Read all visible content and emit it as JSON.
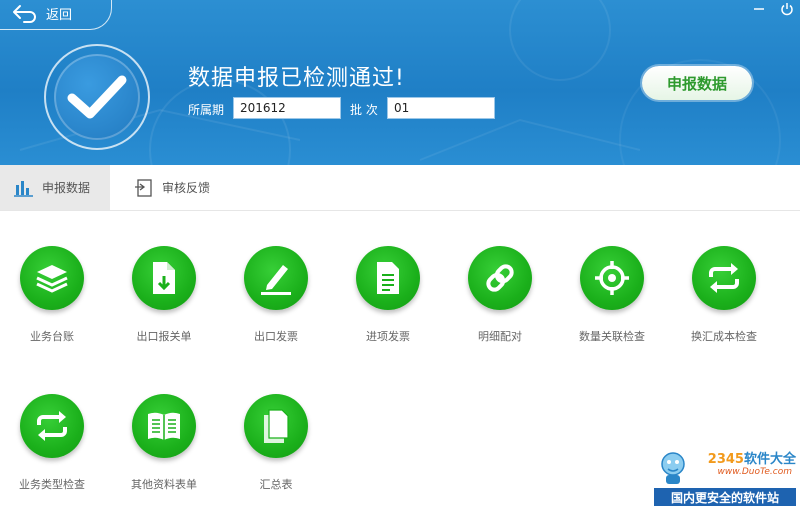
{
  "colors": {
    "header_blue": "#2286cc",
    "green": "#1bb01b",
    "tab_active_bg": "#e9e9e9"
  },
  "header": {
    "back_label": "返回",
    "status_title": "数据申报已检测通过!",
    "period_label": "所属期",
    "period_value": "201612",
    "batch_label": "批 次",
    "batch_value": "01",
    "declare_button": "申报数据",
    "window_buttons": [
      "minimize-icon",
      "power-icon"
    ]
  },
  "tabs": [
    {
      "label": "申报数据",
      "icon": "bar-chart-icon",
      "active": true
    },
    {
      "label": "审核反馈",
      "icon": "feedback-icon",
      "active": false
    }
  ],
  "items": [
    {
      "label": "业务台账",
      "icon": "layers-icon"
    },
    {
      "label": "出口报关单",
      "icon": "file-download-icon"
    },
    {
      "label": "出口发票",
      "icon": "pen-icon"
    },
    {
      "label": "进项发票",
      "icon": "document-icon"
    },
    {
      "label": "明细配对",
      "icon": "link-icon"
    },
    {
      "label": "数量关联检查",
      "icon": "target-icon"
    },
    {
      "label": "换汇成本检查",
      "icon": "exchange-icon"
    },
    {
      "label": "业务类型检查",
      "icon": "exchange-icon"
    },
    {
      "label": "其他资料表单",
      "icon": "book-icon"
    },
    {
      "label": "汇总表",
      "icon": "copy-icon"
    }
  ],
  "watermark": {
    "brand": "2345软件大全",
    "brand_prefix": "2345",
    "brand_suffix": "软件大全",
    "url": "www.DuoTe.com",
    "slogan": "国内更安全的软件站"
  }
}
